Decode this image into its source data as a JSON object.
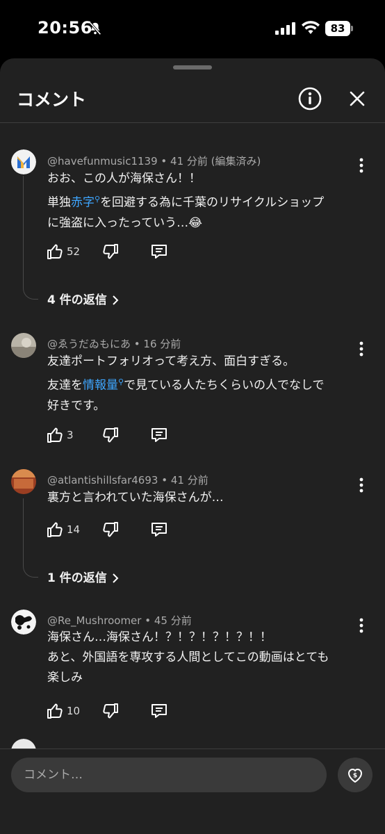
{
  "status": {
    "time": "20:56",
    "battery": "83"
  },
  "header": {
    "title": "コメント"
  },
  "comments": [
    {
      "author": "@havefunmusic1139",
      "time": "41 分前",
      "edited": "(編集済み)",
      "line1": "おお、この人が海保さん！！",
      "line2_pre": "単独",
      "line2_link": "赤字",
      "line2_post": "を回避する為に千葉のリサイクルショップ",
      "line3": "に強盗に入ったっていう…😂",
      "likes": "52",
      "replies": "4 件の返信"
    },
    {
      "author": "@ゑうだゐもにあ",
      "time": "16 分前",
      "line1": "友達ポートフォリオって考え方、面白すぎる。",
      "line2_pre": "友達を",
      "line2_link": "情報量",
      "line2_post": "で見ている人たちくらいの人でなしで",
      "line3": "好きです。",
      "likes": "3"
    },
    {
      "author": "@atlantishillsfar4693",
      "time": "41 分前",
      "line1": "裏方と言われていた海保さんが…",
      "likes": "14",
      "replies": "1 件の返信"
    },
    {
      "author": "@Re_Mushroomer",
      "time": "45 分前",
      "line1": "海保さん…海保さん！？！？！？！？！！",
      "line2": "あと、外国語を専攻する人間としてこの動画はとても",
      "line3": "楽しみ",
      "likes": "10"
    }
  ],
  "input": {
    "placeholder": "コメント…"
  },
  "colors": {
    "sheet": "#212121",
    "link": "#3ea6ff",
    "text": "#f1f1f1",
    "meta": "#aaaaaa"
  }
}
